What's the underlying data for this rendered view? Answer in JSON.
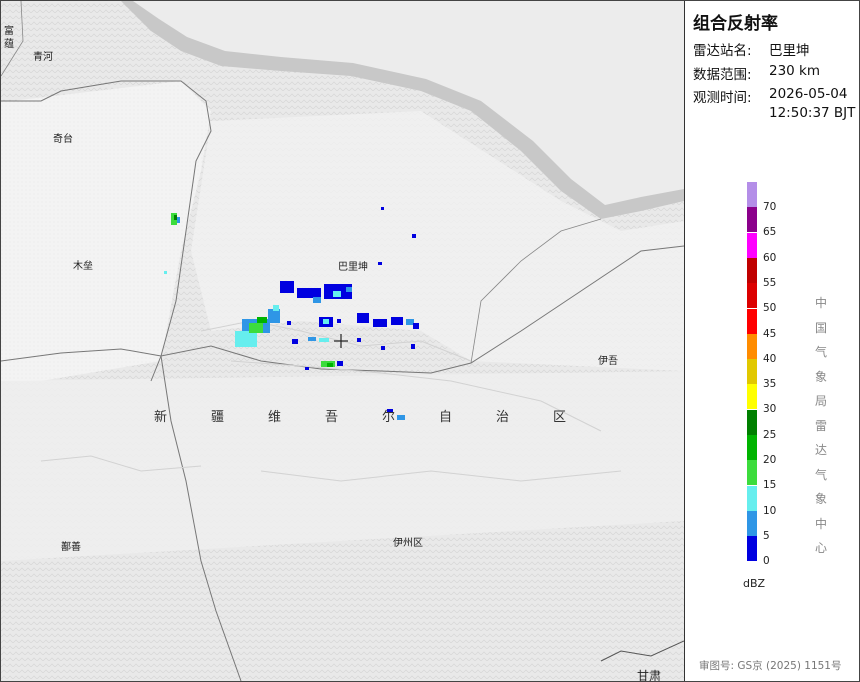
{
  "product": {
    "title": "组合反射率",
    "station_label": "雷达站名:",
    "station_value": "巴里坤",
    "range_label": "数据范围:",
    "range_value": "230 km",
    "time_label": "观测时间:",
    "time_date": "2026-05-04",
    "time_clock": "12:50:37 BJT"
  },
  "legend": {
    "unit": "dBZ",
    "ticks": [
      "70",
      "65",
      "60",
      "55",
      "50",
      "45",
      "40",
      "35",
      "30",
      "25",
      "20",
      "15",
      "10",
      "5",
      "0"
    ],
    "colors": [
      "#b48ee8",
      "#8b008b",
      "#ff00ff",
      "#c00000",
      "#dc0000",
      "#ff0000",
      "#ff8c00",
      "#e1c800",
      "#ffff00",
      "#008000",
      "#00b400",
      "#3cdc3c",
      "#66eeee",
      "#2f96e6",
      "#0000e0"
    ]
  },
  "agency": [
    "中",
    "国",
    "气",
    "象",
    "局",
    "雷",
    "达",
    "气",
    "象",
    "中",
    "心"
  ],
  "approval": "审图号: GS京 (2025) 1151号",
  "map": {
    "places": {
      "fu": "富",
      "yun": "蕴",
      "qinghe": "青河",
      "qitai": "奇台",
      "mulei": "木垒",
      "balikun": "巴里坤",
      "yiwu": "伊吾",
      "shanshan": "鄯善",
      "yizhou": "伊州区",
      "gansu": "甘肃"
    },
    "region_chars": [
      "新",
      "疆",
      "维",
      "吾",
      "尔",
      "自",
      "治",
      "区"
    ],
    "radar_center_symbol": "+"
  }
}
